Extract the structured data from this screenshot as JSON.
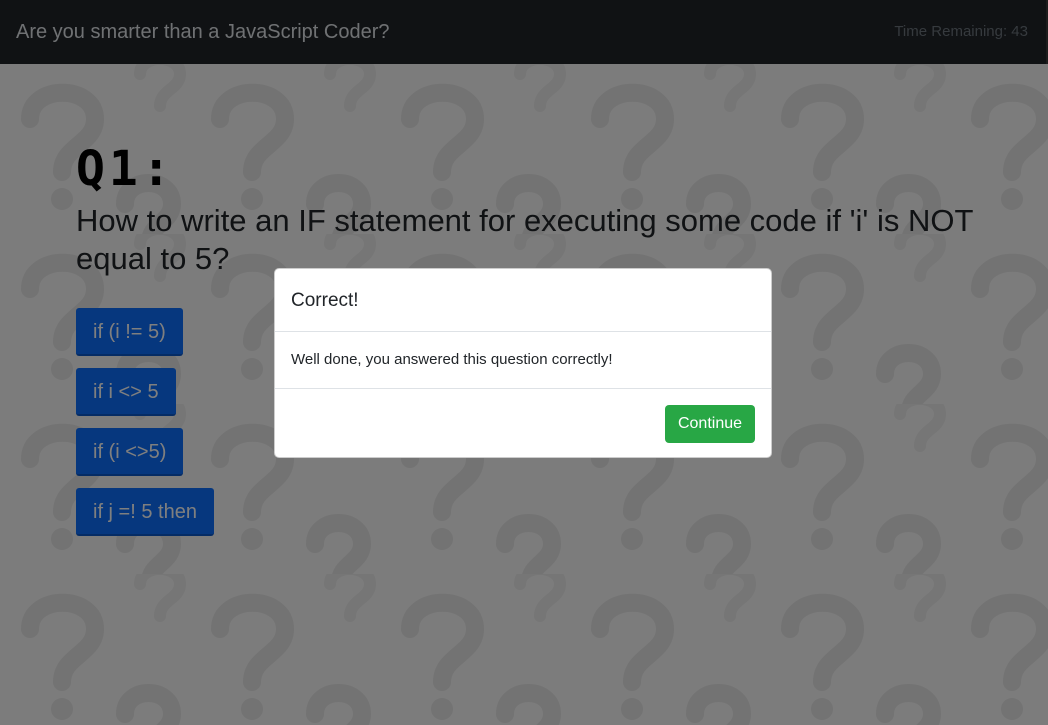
{
  "navbar": {
    "title": "Are you smarter than a JavaScript Coder?",
    "timer": "Time Remaining: 43"
  },
  "question": {
    "number": "Q1:",
    "text": "How to write an IF statement for executing some code if 'i' is NOT equal to 5?"
  },
  "answers": [
    {
      "label": "if (i != 5)"
    },
    {
      "label": "if i <> 5"
    },
    {
      "label": "if (i <>5)"
    },
    {
      "label": "if j =! 5 then"
    }
  ],
  "modal": {
    "title": "Correct!",
    "message": "Well done, you answered this question correctly!",
    "continue_label": "Continue"
  },
  "colors": {
    "navbar": "#212529",
    "answer_button": "#0d6efd",
    "continue_button": "#28a745",
    "backdrop": "rgba(0,0,0,0.5)"
  },
  "icons": {
    "background": "question-mark-pattern"
  }
}
